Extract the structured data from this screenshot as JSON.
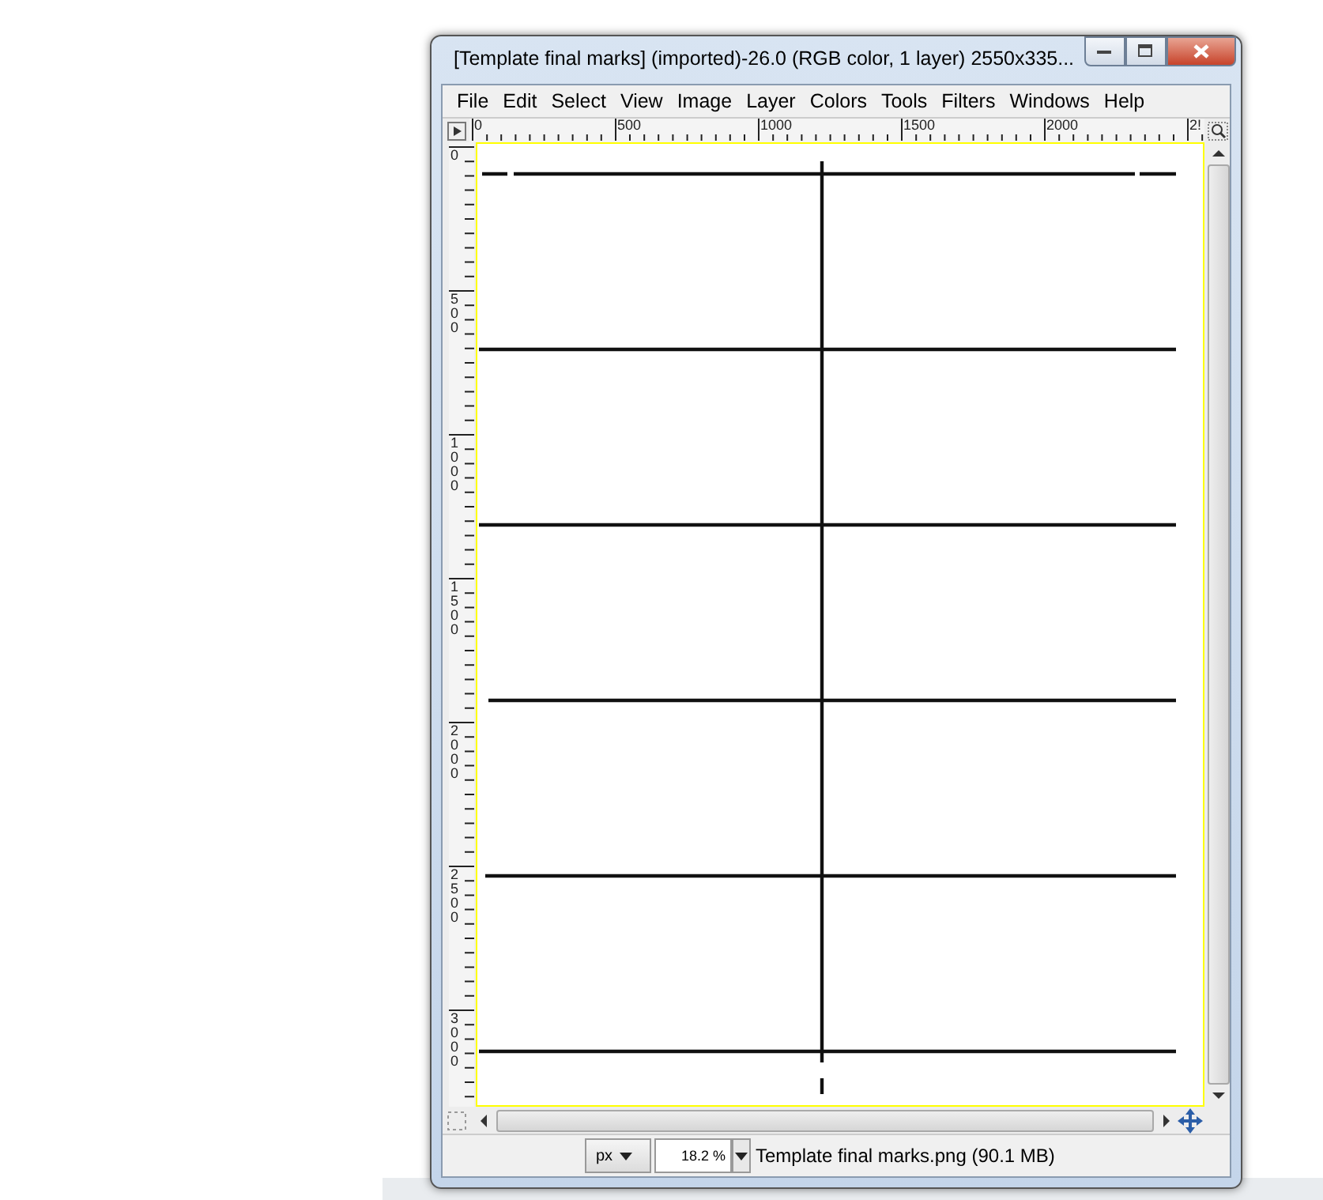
{
  "window": {
    "title": "[Template final marks] (imported)-26.0 (RGB color, 1 layer) 2550x335..."
  },
  "menu": [
    "File",
    "Edit",
    "Select",
    "View",
    "Image",
    "Layer",
    "Colors",
    "Tools",
    "Filters",
    "Windows",
    "Help"
  ],
  "horizontal_ruler": [
    "0",
    "500",
    "1000",
    "1500",
    "2000",
    "2!"
  ],
  "vertical_ruler": [
    "0",
    "500",
    "1000",
    "1500",
    "2000",
    "2500",
    "3000"
  ],
  "status_bar": {
    "unit": "px",
    "zoom": "18.2 %",
    "file_info": "Template final marks.png (90.1 MB)"
  }
}
